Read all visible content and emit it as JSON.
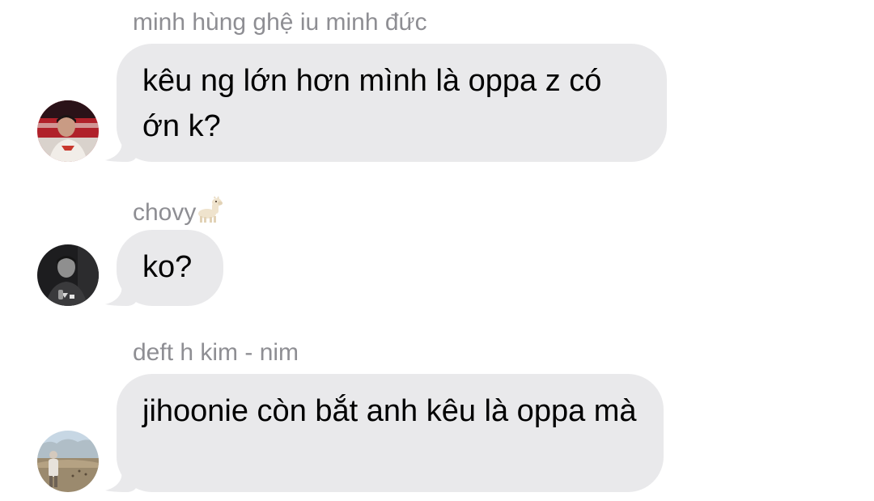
{
  "conversation": {
    "messages": [
      {
        "sender": "minh hùng ghệ iu minh đức",
        "sender_emoji": "",
        "text": "kêu ng lớn hơn mình là oppa z có ớn k?",
        "avatar_icon": "red-stage-avatar-icon"
      },
      {
        "sender": "chovy",
        "sender_emoji": "llama-emoji",
        "text": "ko?",
        "avatar_icon": "dark-portrait-avatar-icon"
      },
      {
        "sender": "deft h kim - nim",
        "sender_emoji": "",
        "text": "jihoonie còn bắt anh kêu là oppa mà",
        "avatar_icon": "landscape-avatar-icon"
      }
    ]
  },
  "colors": {
    "bubble": "#e9e9eb",
    "sender_text": "#8e8e93",
    "message_text": "#000000",
    "background": "#ffffff"
  }
}
